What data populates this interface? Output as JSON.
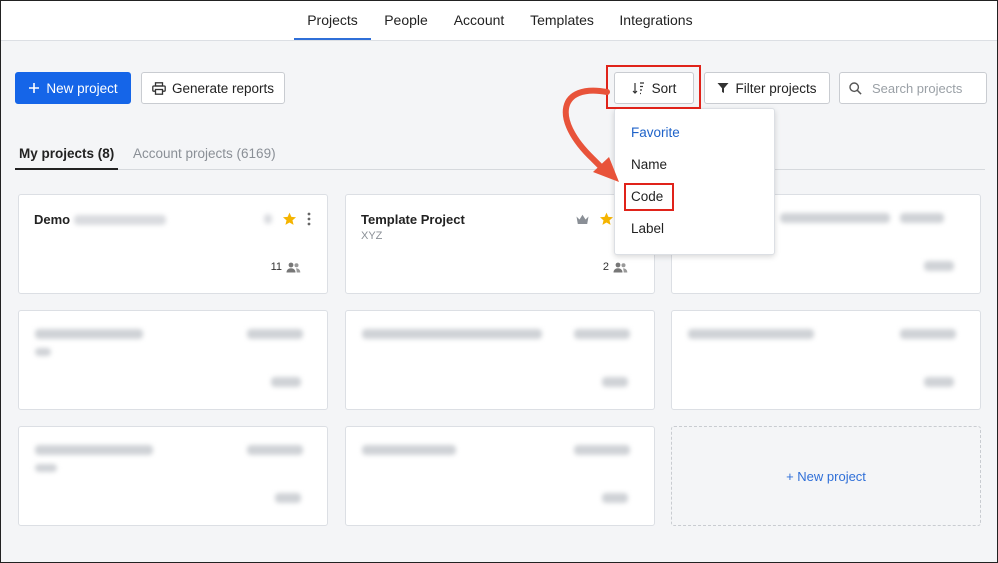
{
  "nav": {
    "tabs": [
      {
        "label": "Projects",
        "active": true
      },
      {
        "label": "People"
      },
      {
        "label": "Account"
      },
      {
        "label": "Templates"
      },
      {
        "label": "Integrations"
      }
    ]
  },
  "toolbar": {
    "new_project_label": "New project",
    "generate_reports_label": "Generate reports",
    "sort_label": "Sort",
    "filter_label": "Filter projects",
    "search_placeholder": "Search projects"
  },
  "subtabs": {
    "my_projects": "My projects (8)",
    "account_projects": "Account projects (6169)"
  },
  "sort_menu": {
    "items": [
      "Favorite",
      "Name",
      "Code",
      "Label"
    ],
    "selected": "Favorite"
  },
  "cards": [
    {
      "title": "Demo",
      "code": "",
      "members": "11",
      "favorite": true
    },
    {
      "title": "Template Project",
      "code": "XYZ",
      "members": "2",
      "favorite": true
    }
  ],
  "new_project_card_label": "+ New project",
  "colors": {
    "primary": "#1565e8",
    "link": "#2f6fd8",
    "highlight": "#e0231a",
    "star": "#f5b400"
  }
}
